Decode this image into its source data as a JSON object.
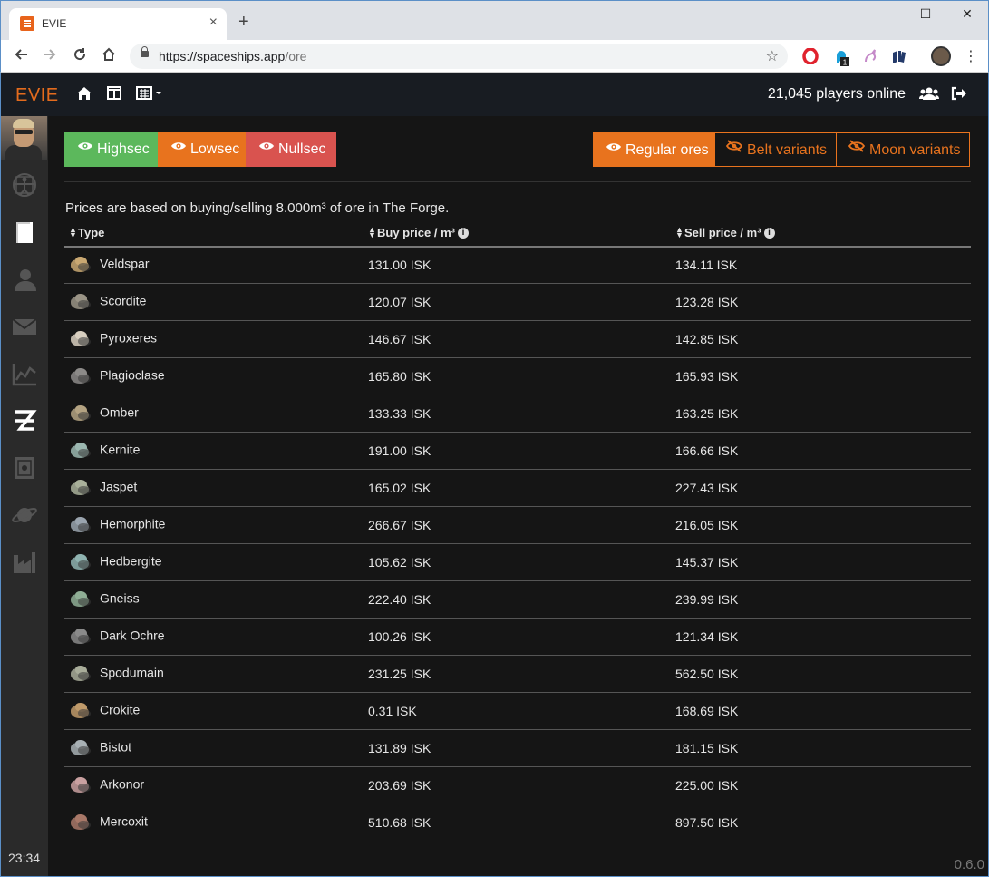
{
  "browser": {
    "tab_title": "EVIE",
    "tab_close": "×",
    "new_tab": "+",
    "url_host": "https://spaceships.app",
    "url_path": "/ore",
    "window_controls": [
      "—",
      "☐",
      "✕"
    ]
  },
  "app": {
    "brand": "EVIE",
    "players_online": "21,045 players online",
    "clock": "23:34",
    "version": "0.6.0",
    "accent_color": "#e8731e"
  },
  "filters": {
    "security": [
      {
        "label": "Highsec",
        "color": "#5cb85c"
      },
      {
        "label": "Lowsec",
        "color": "#e8731e"
      },
      {
        "label": "Nullsec",
        "color": "#d9534f"
      }
    ],
    "variants": [
      {
        "label": "Regular ores",
        "active": true
      },
      {
        "label": "Belt variants",
        "active": false
      },
      {
        "label": "Moon variants",
        "active": false
      }
    ]
  },
  "note": "Prices are based on buying/selling 8.000m³ of ore in The Forge.",
  "table": {
    "columns": [
      "Type",
      "Buy price / m³",
      "Sell price / m³"
    ],
    "rows": [
      {
        "type": "Veldspar",
        "buy": "131.00 ISK",
        "sell": "134.11 ISK",
        "color": "#c9a872"
      },
      {
        "type": "Scordite",
        "buy": "120.07 ISK",
        "sell": "123.28 ISK",
        "color": "#9a9486"
      },
      {
        "type": "Pyroxeres",
        "buy": "146.67 ISK",
        "sell": "142.85 ISK",
        "color": "#d8cfc0"
      },
      {
        "type": "Plagioclase",
        "buy": "165.80 ISK",
        "sell": "165.93 ISK",
        "color": "#8c8a88"
      },
      {
        "type": "Omber",
        "buy": "133.33 ISK",
        "sell": "163.25 ISK",
        "color": "#b4a382"
      },
      {
        "type": "Kernite",
        "buy": "191.00 ISK",
        "sell": "166.66 ISK",
        "color": "#9bb7b0"
      },
      {
        "type": "Jaspet",
        "buy": "165.02 ISK",
        "sell": "227.43 ISK",
        "color": "#a9b09a"
      },
      {
        "type": "Hemorphite",
        "buy": "266.67 ISK",
        "sell": "216.05 ISK",
        "color": "#9aa4ae"
      },
      {
        "type": "Hedbergite",
        "buy": "105.62 ISK",
        "sell": "145.37 ISK",
        "color": "#8fb3b0"
      },
      {
        "type": "Gneiss",
        "buy": "222.40 ISK",
        "sell": "239.99 ISK",
        "color": "#8fae95"
      },
      {
        "type": "Dark Ochre",
        "buy": "100.26 ISK",
        "sell": "121.34 ISK",
        "color": "#8a8a8a"
      },
      {
        "type": "Spodumain",
        "buy": "231.25 ISK",
        "sell": "562.50 ISK",
        "color": "#a9ad9a"
      },
      {
        "type": "Crokite",
        "buy": "0.31 ISK",
        "sell": "168.69 ISK",
        "color": "#c09a6a"
      },
      {
        "type": "Bistot",
        "buy": "131.89 ISK",
        "sell": "181.15 ISK",
        "color": "#a8b0b4"
      },
      {
        "type": "Arkonor",
        "buy": "203.69 ISK",
        "sell": "225.00 ISK",
        "color": "#c9a0a0"
      },
      {
        "type": "Mercoxit",
        "buy": "510.68 ISK",
        "sell": "897.50 ISK",
        "color": "#a87868"
      }
    ]
  }
}
